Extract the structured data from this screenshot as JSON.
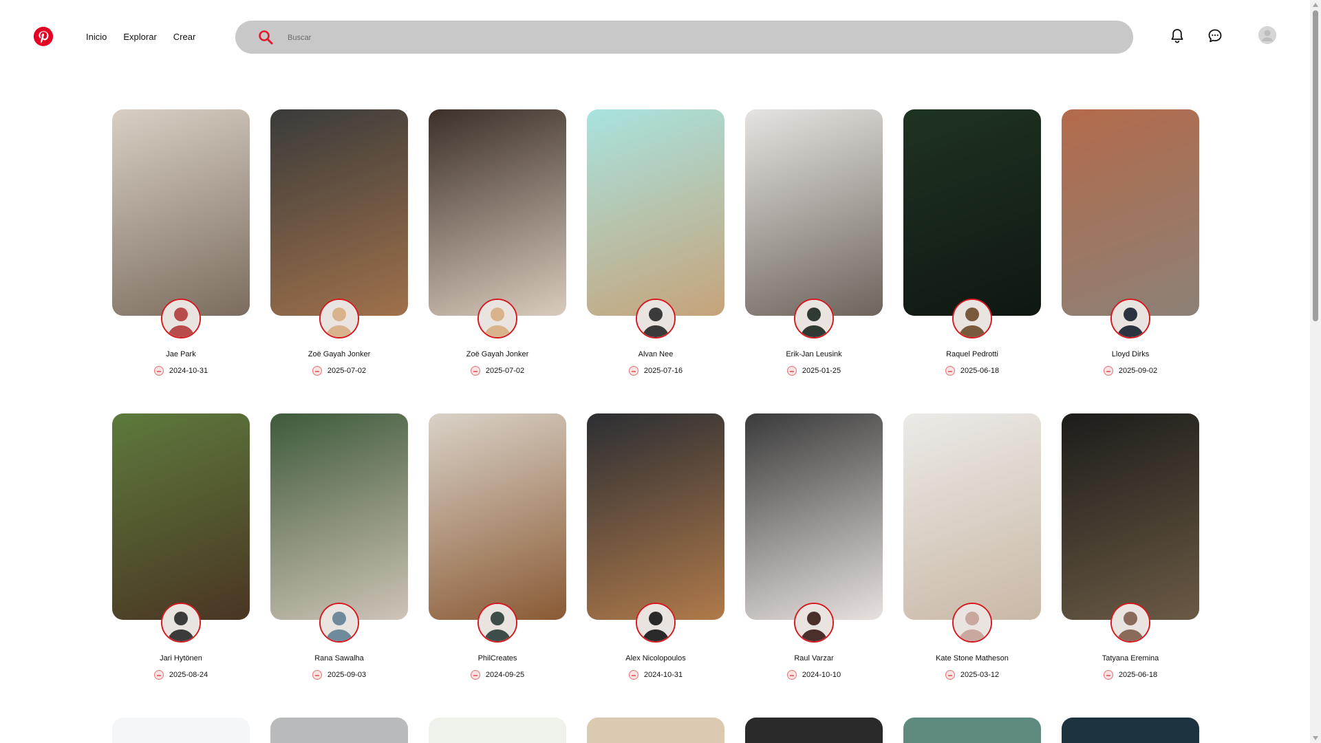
{
  "nav": {
    "items": [
      "Inicio",
      "Explorar",
      "Crear"
    ]
  },
  "search": {
    "placeholder": "Buscar"
  },
  "colors": {
    "brand": "#e60023",
    "avatar_ring": "#d7191f",
    "search_bg": "#c8c8c8"
  },
  "icons": {
    "logo": "pinterest-logo",
    "search": "search-icon",
    "notifications": "bell-icon",
    "messages": "chat-bubble-icon",
    "profile": "user-avatar"
  },
  "pins": [
    {
      "name": "Jae Park",
      "date": "2024-10-31",
      "img_colors": [
        "#d8cfc4",
        "#7b6c5f"
      ],
      "av_color": "#b84b4b"
    },
    {
      "name": "Zoë Gayah Jonker",
      "date": "2025-07-02",
      "img_colors": [
        "#3a3b3a",
        "#a0714b"
      ],
      "av_color": "#d9b38c"
    },
    {
      "name": "Zoë Gayah Jonker",
      "date": "2025-07-02",
      "img_colors": [
        "#3c2f28",
        "#d9cbbd"
      ],
      "av_color": "#d9b38c"
    },
    {
      "name": "Alvan Nee",
      "date": "2025-07-16",
      "img_colors": [
        "#a8e3df",
        "#c6a37a"
      ],
      "av_color": "#3a3a3a"
    },
    {
      "name": "Erik-Jan Leusink",
      "date": "2025-01-25",
      "img_colors": [
        "#e6e3e0",
        "#6d655c"
      ],
      "av_color": "#2f3a35"
    },
    {
      "name": "Raquel Pedrotti",
      "date": "2025-06-18",
      "img_colors": [
        "#1f3322",
        "#0f1712"
      ],
      "av_color": "#7a5a3c"
    },
    {
      "name": "Lloyd Dirks",
      "date": "2025-09-02",
      "img_colors": [
        "#b36a4a",
        "#8c8177"
      ],
      "av_color": "#2b3440"
    },
    {
      "name": "Jari Hytönen",
      "date": "2025-08-24",
      "img_colors": [
        "#5d7a3c",
        "#4a3523"
      ],
      "av_color": "#3b3b3b"
    },
    {
      "name": "Rana Sawalha",
      "date": "2025-09-03",
      "img_colors": [
        "#3e5a3a",
        "#cfc4b8"
      ],
      "av_color": "#6f8a9a"
    },
    {
      "name": "PhilCreates",
      "date": "2024-09-25",
      "img_colors": [
        "#d9d2c8",
        "#8a5a34"
      ],
      "av_color": "#3d4d4a"
    },
    {
      "name": "Alex Nicolopoulos",
      "date": "2024-10-31",
      "img_colors": [
        "#2c2e33",
        "#b07a4a"
      ],
      "av_color": "#2a2a2a"
    },
    {
      "name": "Raul Varzar",
      "date": "2024-10-10",
      "img_colors": [
        "#3a3a3a",
        "#e8e2df"
      ],
      "av_color": "#4a2f2a"
    },
    {
      "name": "Kate Stone Matheson",
      "date": "2025-03-12",
      "img_colors": [
        "#eceae7",
        "#c9b8a6"
      ],
      "av_color": "#c9a8a0"
    },
    {
      "name": "Tatyana Eremina",
      "date": "2025-06-18",
      "img_colors": [
        "#1d1c1a",
        "#6a5a44"
      ],
      "av_color": "#8a6a5a"
    }
  ],
  "partial_row_colors": [
    "#f4f6f8",
    "#b8babb",
    "#eef2ea",
    "#dcc9b2",
    "#2a2a2a",
    "#5e8a80",
    "#1e3340"
  ]
}
